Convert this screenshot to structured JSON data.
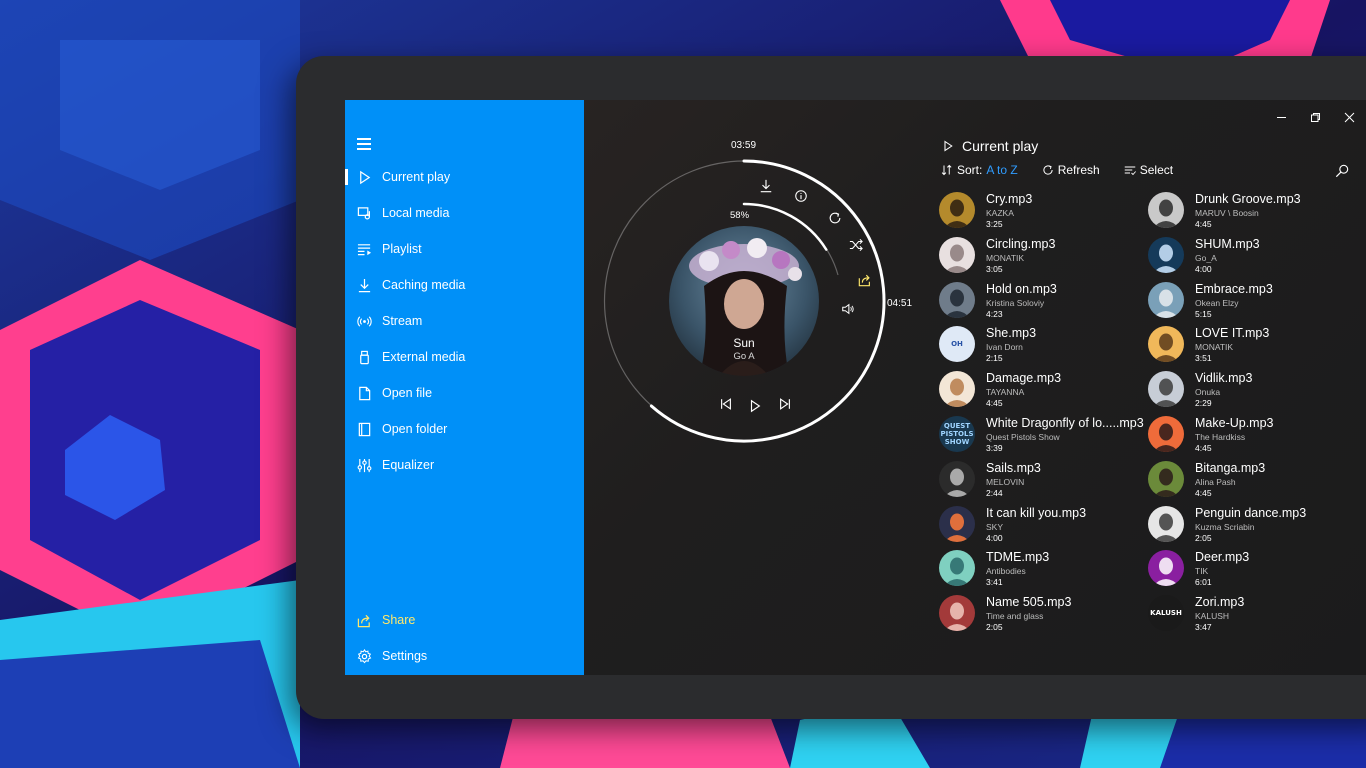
{
  "sidebar": {
    "items": [
      {
        "label": "Current play",
        "icon": "play-outline-icon"
      },
      {
        "label": "Local media",
        "icon": "local-media-icon"
      },
      {
        "label": "Playlist",
        "icon": "playlist-icon"
      },
      {
        "label": "Caching media",
        "icon": "download-icon"
      },
      {
        "label": "Stream",
        "icon": "stream-icon"
      },
      {
        "label": "External media",
        "icon": "usb-drive-icon"
      },
      {
        "label": "Open file",
        "icon": "file-icon"
      },
      {
        "label": "Open folder",
        "icon": "folder-icon"
      },
      {
        "label": "Equalizer",
        "icon": "equalizer-icon"
      }
    ],
    "share": {
      "label": "Share",
      "icon": "share-icon"
    },
    "settings": {
      "label": "Settings",
      "icon": "gear-icon"
    }
  },
  "player": {
    "elapsed": "03:59",
    "total": "04:51",
    "volume_percent": "58%",
    "progress_fraction": 0.82,
    "volume_fraction": 0.58,
    "song_title": "Sun",
    "song_artist": "Go A"
  },
  "playlist": {
    "title": "Current play",
    "sort_label": "Sort:",
    "sort_value": "A to Z",
    "refresh_label": "Refresh",
    "select_label": "Select"
  },
  "tracks": [
    {
      "name": "Cry.mp3",
      "artist": "KAZKA",
      "duration": "3:25"
    },
    {
      "name": "Drunk Groove.mp3",
      "artist": "MARUV \\ Boosin",
      "duration": "4:45"
    },
    {
      "name": "Circling.mp3",
      "artist": "MONATIK",
      "duration": "3:05"
    },
    {
      "name": "SHUM.mp3",
      "artist": "Go_A",
      "duration": "4:00"
    },
    {
      "name": "Hold on.mp3",
      "artist": "Kristina Soloviy",
      "duration": "4:23"
    },
    {
      "name": "Embrace.mp3",
      "artist": "Okean Elzy",
      "duration": "5:15"
    },
    {
      "name": "She.mp3",
      "artist": "Ivan Dorn",
      "duration": "2:15"
    },
    {
      "name": "LOVE IT.mp3",
      "artist": "MONATIK",
      "duration": "3:51"
    },
    {
      "name": "Damage.mp3",
      "artist": "TAYANNA",
      "duration": "4:45"
    },
    {
      "name": "Vidlik.mp3",
      "artist": "Onuka",
      "duration": "2:29"
    },
    {
      "name": "White Dragonfly of lo.....mp3",
      "artist": "Quest Pistols Show",
      "duration": "3:39"
    },
    {
      "name": "Make-Up.mp3",
      "artist": "The Hardkiss",
      "duration": "4:45"
    },
    {
      "name": "Sails.mp3",
      "artist": "MELOVIN",
      "duration": "2:44"
    },
    {
      "name": "Bitanga.mp3",
      "artist": "Alina Pash",
      "duration": "4:45"
    },
    {
      "name": "It can kill you.mp3",
      "artist": "SKY",
      "duration": "4:00"
    },
    {
      "name": "Penguin dance.mp3",
      "artist": "Kuzma Scriabin",
      "duration": "2:05"
    },
    {
      "name": "TDME.mp3",
      "artist": "Antibodies",
      "duration": "3:41"
    },
    {
      "name": "Deer.mp3",
      "artist": "TIK",
      "duration": "6:01"
    },
    {
      "name": "Name 505.mp3",
      "artist": "Time and glass",
      "duration": "2:05"
    },
    {
      "name": "Zori.mp3",
      "artist": "KALUSH",
      "duration": "3:47"
    }
  ],
  "cover_text": {
    "she": "ОН",
    "white_dragonfly": "QUEST PISTOLS SHOW",
    "zori": "KALUSH"
  },
  "colors": {
    "sidebar": "#0090f8",
    "accent": "#2f9cff",
    "share": "#ffe86b"
  }
}
